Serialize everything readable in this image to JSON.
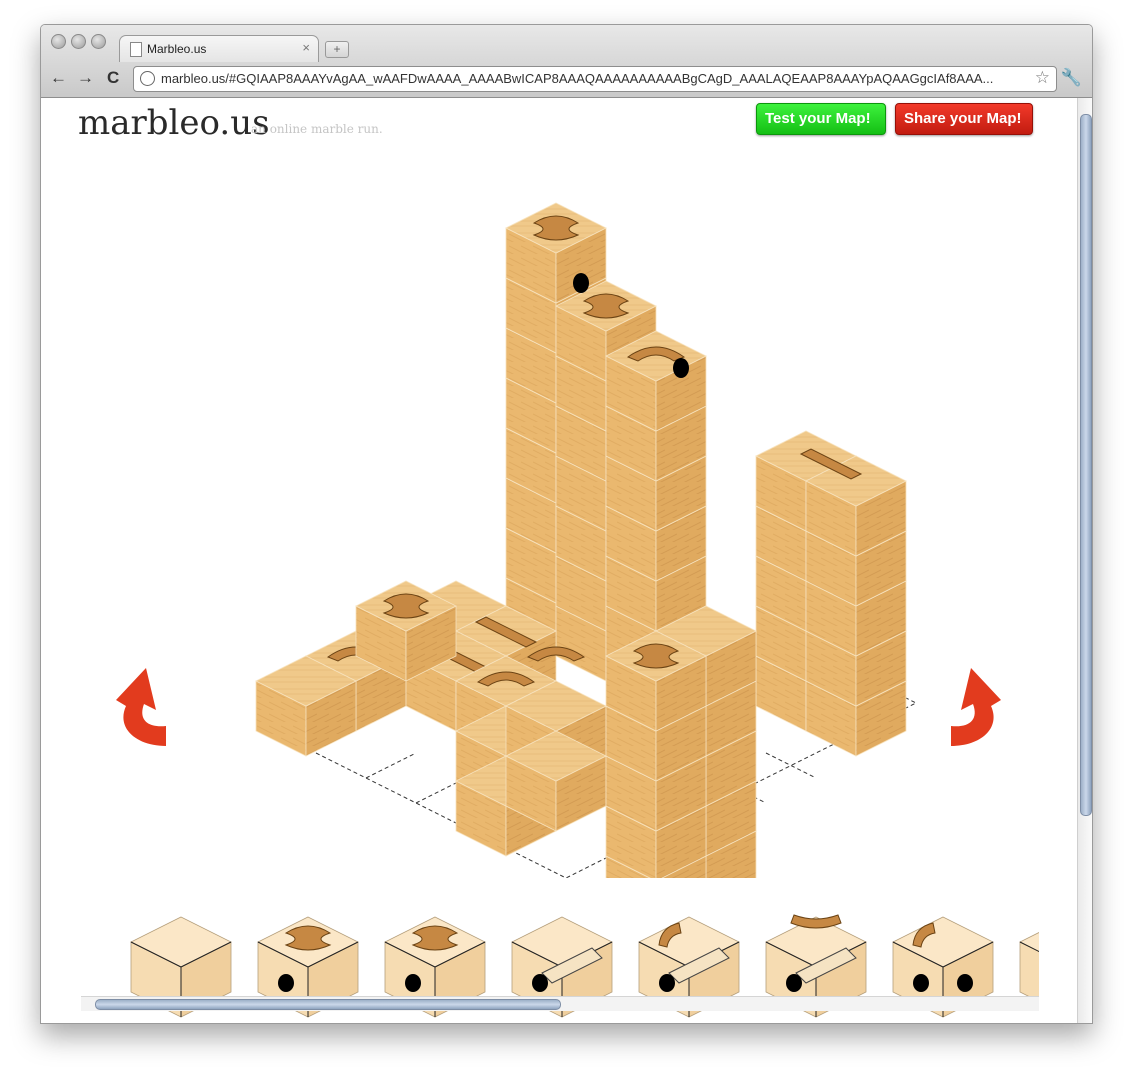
{
  "browser": {
    "tab_title": "Marbleo.us",
    "tab_close": "×",
    "new_tab": "+",
    "back": "←",
    "forward": "→",
    "reload": "C",
    "url": "marbleo.us/#GQIAAP8AAAYvAgAA_wAAFDwAAAA_AAAABwICAP8AAAQAAAAAAAAAABgCAgD_AAALAQEAAP8AAAYpAQAAGgcIAf8AAA...",
    "star": "☆",
    "wrench": "🔧"
  },
  "page": {
    "logo": "marbleo.us",
    "tagline": "an online marble run.",
    "test_button": "Test your Map!",
    "share_button": "Share your Map!"
  },
  "colors": {
    "wood_top": "#f0c98a",
    "wood_left": "#e8b56c",
    "wood_right": "#d69f55",
    "groove": "#b97a35",
    "test_green": "#22d322",
    "share_red": "#d7261a",
    "arrow_red": "#e23b1e"
  },
  "palette": {
    "items": [
      {
        "name": "blank-cube",
        "icon": "cube-plain-icon"
      },
      {
        "name": "cross-drop-left",
        "icon": "cube-cross-hole-icon"
      },
      {
        "name": "cross-drop-curve",
        "icon": "cube-cross-curve-icon"
      },
      {
        "name": "straight-tube",
        "icon": "cube-straight-icon"
      },
      {
        "name": "curve-tube",
        "icon": "cube-curve-tube-icon"
      },
      {
        "name": "arc-top-tube",
        "icon": "cube-arc-icon"
      },
      {
        "name": "double-hole",
        "icon": "cube-double-hole-icon"
      },
      {
        "name": "partial-cube",
        "icon": "cube-partial-icon"
      }
    ]
  }
}
